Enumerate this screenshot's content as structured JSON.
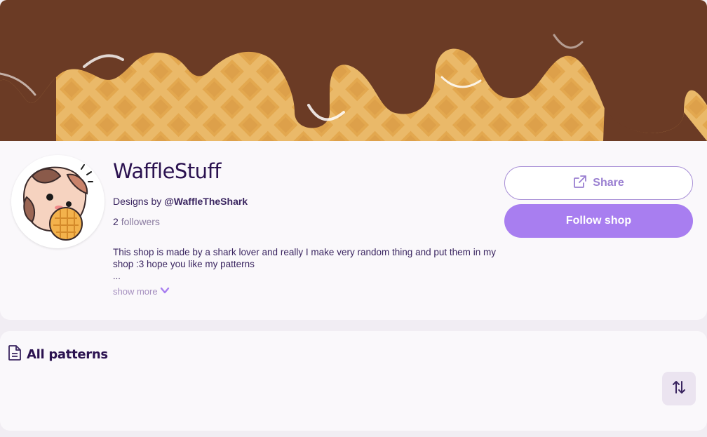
{
  "shop": {
    "name": "WaffleStuff",
    "designs_by_prefix": "Designs by",
    "handle": "@WaffleTheShark",
    "followers_count": "2",
    "followers_label": "followers",
    "description": "This shop is made by a shark lover and really I make very random thing and put them in my shop :3 hope you like my patterns",
    "ellipsis": "...",
    "show_more_label": "show more"
  },
  "actions": {
    "share_label": "Share",
    "follow_label": "Follow shop"
  },
  "patterns": {
    "title": "All patterns"
  },
  "icons": {
    "share": "external-link-icon",
    "show_more": "chevron-down-icon",
    "patterns": "document-icon",
    "sort": "sort-arrows-icon"
  },
  "colors": {
    "accent": "#a87ef0",
    "title": "#2b1250",
    "banner_chocolate": "#6b3b25",
    "banner_waffle": "#e8b56a"
  }
}
